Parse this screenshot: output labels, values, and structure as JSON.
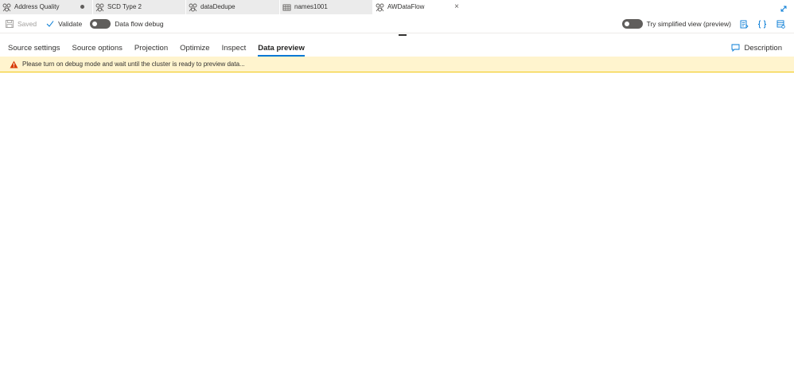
{
  "tabs": [
    {
      "label": "Address Quality",
      "icon": "dataflow-icon",
      "modified": true,
      "active": false
    },
    {
      "label": "SCD Type 2",
      "icon": "dataflow-icon",
      "modified": false,
      "active": false
    },
    {
      "label": "dataDedupe",
      "icon": "dataflow-icon",
      "modified": false,
      "active": false
    },
    {
      "label": "names1001",
      "icon": "dataset-icon",
      "modified": false,
      "active": false
    },
    {
      "label": "AWDataFlow",
      "icon": "dataflow-icon",
      "modified": false,
      "active": true,
      "close_label": "×"
    }
  ],
  "toolbar": {
    "saved_label": "Saved",
    "validate_label": "Validate",
    "debug_label": "Data flow debug",
    "debug_on": false,
    "simplified_label": "Try simplified view (preview)",
    "simplified_on": false
  },
  "settings_tabs": [
    {
      "label": "Source settings",
      "active": false
    },
    {
      "label": "Source options",
      "active": false
    },
    {
      "label": "Projection",
      "active": false
    },
    {
      "label": "Optimize",
      "active": false
    },
    {
      "label": "Inspect",
      "active": false
    },
    {
      "label": "Data preview",
      "active": true
    }
  ],
  "description_label": "Description",
  "warning": {
    "message": "Please turn on debug mode and wait until the cluster is ready to preview data..."
  },
  "colors": {
    "accent": "#0078d4",
    "warning_bg": "#fff4ce",
    "warning_icon": "#d83b01"
  }
}
